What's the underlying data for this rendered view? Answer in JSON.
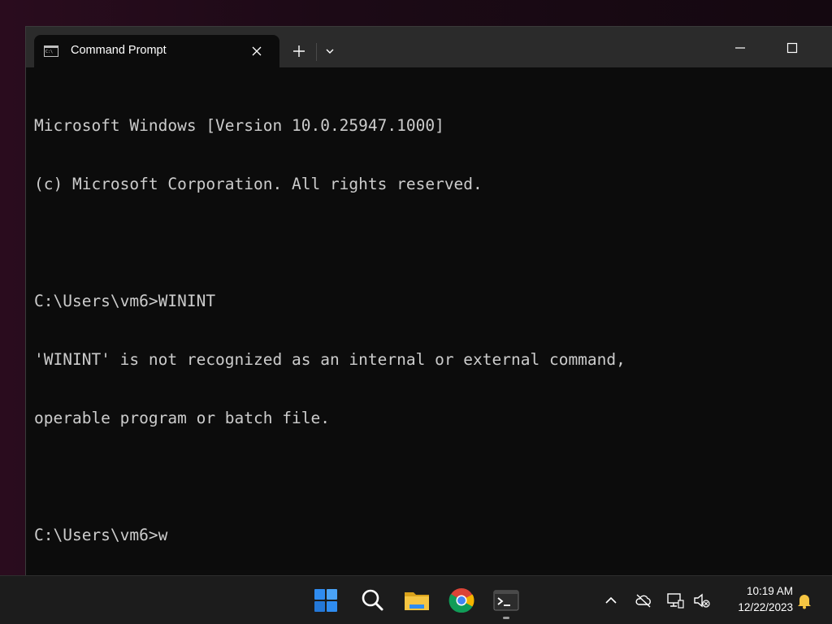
{
  "window": {
    "tab_title": "Command Prompt",
    "tab_icon": "cmd-icon",
    "controls": {
      "new_tab": "plus-icon",
      "dropdown": "chevron-down-icon",
      "close_tab": "close-icon",
      "minimize": "minimize-icon",
      "maximize": "maximize-icon"
    }
  },
  "console": {
    "lines": [
      "Microsoft Windows [Version 10.0.25947.1000]",
      "(c) Microsoft Corporation. All rights reserved.",
      "",
      "C:\\Users\\vm6>WININT",
      "'WININT' is not recognized as an internal or external command,",
      "operable program or batch file.",
      "",
      "C:\\Users\\vm6>w"
    ]
  },
  "taskbar": {
    "apps": [
      "windows-start-icon",
      "search-icon",
      "file-explorer-icon",
      "chrome-icon",
      "terminal-icon"
    ],
    "tray": [
      "chevron-up-icon",
      "onedrive-offline-icon",
      "network-icon",
      "volume-muted-icon",
      "notification-bell-icon"
    ],
    "time": "10:19 AM",
    "date": "12/22/2023"
  },
  "colors": {
    "console_bg": "#0c0c0c",
    "console_text": "#cccccc",
    "titlebar": "#2b2b2b",
    "taskbar": "#1c1c1c",
    "accent_blue": "#2f8cf0",
    "folder_yellow": "#f5c542"
  }
}
